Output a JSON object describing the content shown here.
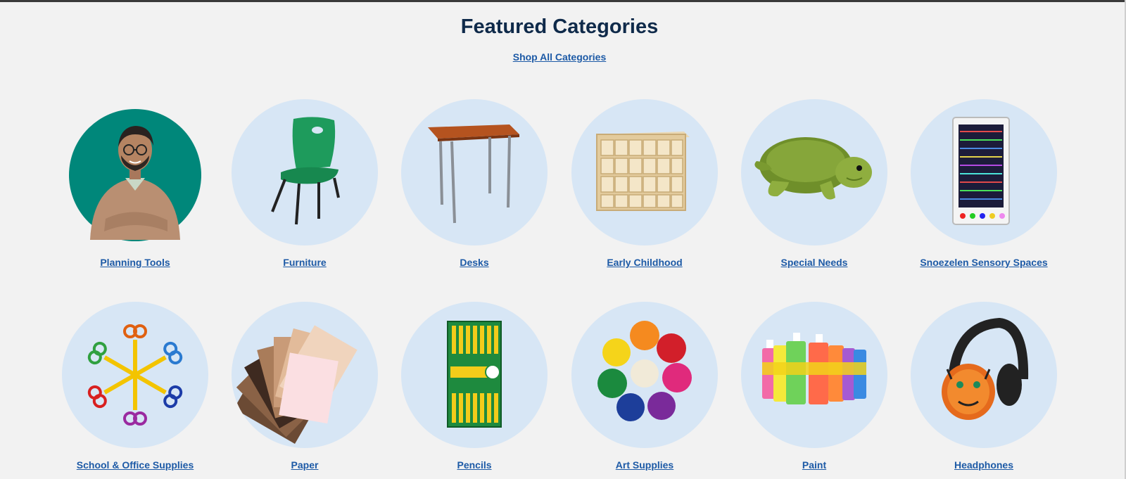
{
  "section": {
    "title": "Featured Categories",
    "shop_all_label": "Shop All Categories"
  },
  "colors": {
    "page_background": "#f2f2f2",
    "circle_background": "#d7e6f5",
    "title": "#0f2a4a",
    "link": "#1d5aa6",
    "planning_circle": "#00877a"
  },
  "categories": [
    {
      "label": "Planning Tools",
      "icon": "teacher-photo-icon"
    },
    {
      "label": "Furniture",
      "icon": "chair-icon"
    },
    {
      "label": "Desks",
      "icon": "desk-icon"
    },
    {
      "label": "Early Childhood",
      "icon": "cubby-shelf-icon"
    },
    {
      "label": "Special Needs",
      "icon": "plush-turtle-icon"
    },
    {
      "label": "Snoezelen Sensory Spaces",
      "icon": "sensory-light-panel-icon"
    },
    {
      "label": "School & Office Supplies",
      "icon": "scissors-icon"
    },
    {
      "label": "Paper",
      "icon": "paper-fan-icon"
    },
    {
      "label": "Pencils",
      "icon": "pencil-box-icon"
    },
    {
      "label": "Art Supplies",
      "icon": "dough-balls-icon"
    },
    {
      "label": "Paint",
      "icon": "paint-bottles-icon"
    },
    {
      "label": "Headphones",
      "icon": "headphones-icon"
    }
  ]
}
